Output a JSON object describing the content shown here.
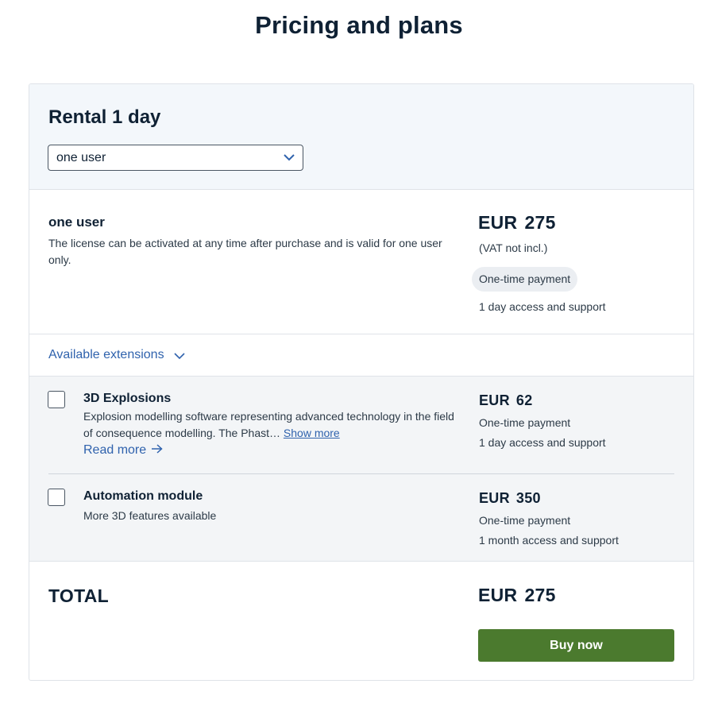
{
  "page_title": "Pricing and plans",
  "plan": {
    "title": "Rental 1 day",
    "select": {
      "value": "one user",
      "icon": "chevron-down-icon"
    }
  },
  "license": {
    "name": "one user",
    "description": "The license can be activated at any time after purchase and is valid for one user only.",
    "currency": "EUR",
    "price": "275",
    "vat_note": "(VAT not incl.)",
    "payment_badge": "One-time payment",
    "access": "1 day access and support"
  },
  "extensions": {
    "toggle_label": "Available extensions",
    "toggle_icon": "chevron-down-icon",
    "items": [
      {
        "name": "3D Explosions",
        "description": "Explosion modelling software representing advanced technology in the field of consequence modelling. The Phast…",
        "show_more": "Show more",
        "read_more": "Read more",
        "read_more_icon": "arrow-right-icon",
        "currency": "EUR",
        "price": "62",
        "payment": "One-time payment",
        "access": "1 day access and support",
        "checked": false
      },
      {
        "name": "Automation module",
        "description": "More 3D features available",
        "currency": "EUR",
        "price": "350",
        "payment": "One-time payment",
        "access": "1 month access and support",
        "checked": false
      }
    ]
  },
  "total": {
    "label": "TOTAL",
    "currency": "EUR",
    "price": "275",
    "buy_label": "Buy now"
  },
  "colors": {
    "accent_link": "#2f62ad",
    "buy_button": "#4b7a2e",
    "header_bg": "#f3f7fb",
    "extensions_bg": "#f3f5f7",
    "text": "#0f2134"
  }
}
